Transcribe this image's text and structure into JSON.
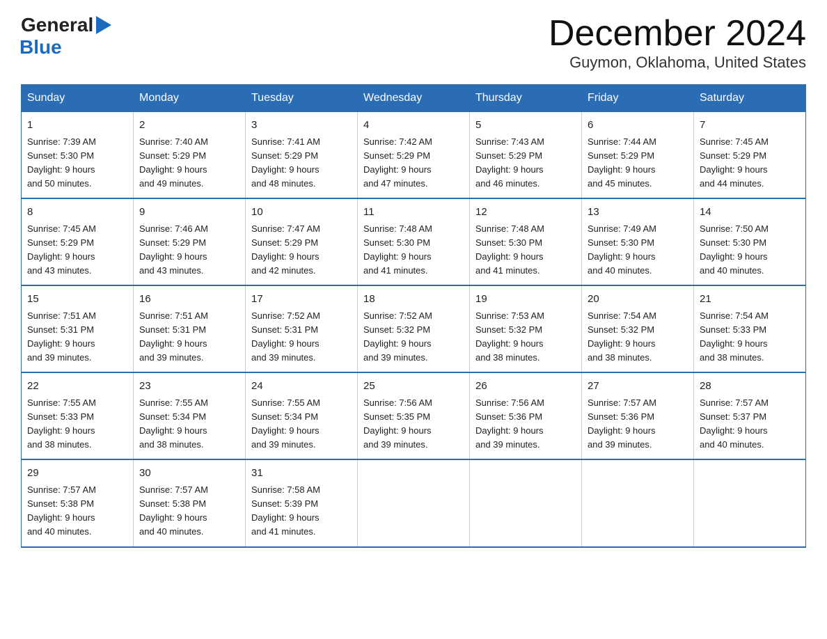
{
  "logo": {
    "general": "General",
    "blue": "Blue",
    "arrow": "▶"
  },
  "title": "December 2024",
  "subtitle": "Guymon, Oklahoma, United States",
  "days_of_week": [
    "Sunday",
    "Monday",
    "Tuesday",
    "Wednesday",
    "Thursday",
    "Friday",
    "Saturday"
  ],
  "weeks": [
    [
      {
        "day": "1",
        "sunrise": "7:39 AM",
        "sunset": "5:30 PM",
        "daylight": "9 hours and 50 minutes."
      },
      {
        "day": "2",
        "sunrise": "7:40 AM",
        "sunset": "5:29 PM",
        "daylight": "9 hours and 49 minutes."
      },
      {
        "day": "3",
        "sunrise": "7:41 AM",
        "sunset": "5:29 PM",
        "daylight": "9 hours and 48 minutes."
      },
      {
        "day": "4",
        "sunrise": "7:42 AM",
        "sunset": "5:29 PM",
        "daylight": "9 hours and 47 minutes."
      },
      {
        "day": "5",
        "sunrise": "7:43 AM",
        "sunset": "5:29 PM",
        "daylight": "9 hours and 46 minutes."
      },
      {
        "day": "6",
        "sunrise": "7:44 AM",
        "sunset": "5:29 PM",
        "daylight": "9 hours and 45 minutes."
      },
      {
        "day": "7",
        "sunrise": "7:45 AM",
        "sunset": "5:29 PM",
        "daylight": "9 hours and 44 minutes."
      }
    ],
    [
      {
        "day": "8",
        "sunrise": "7:45 AM",
        "sunset": "5:29 PM",
        "daylight": "9 hours and 43 minutes."
      },
      {
        "day": "9",
        "sunrise": "7:46 AM",
        "sunset": "5:29 PM",
        "daylight": "9 hours and 43 minutes."
      },
      {
        "day": "10",
        "sunrise": "7:47 AM",
        "sunset": "5:29 PM",
        "daylight": "9 hours and 42 minutes."
      },
      {
        "day": "11",
        "sunrise": "7:48 AM",
        "sunset": "5:30 PM",
        "daylight": "9 hours and 41 minutes."
      },
      {
        "day": "12",
        "sunrise": "7:48 AM",
        "sunset": "5:30 PM",
        "daylight": "9 hours and 41 minutes."
      },
      {
        "day": "13",
        "sunrise": "7:49 AM",
        "sunset": "5:30 PM",
        "daylight": "9 hours and 40 minutes."
      },
      {
        "day": "14",
        "sunrise": "7:50 AM",
        "sunset": "5:30 PM",
        "daylight": "9 hours and 40 minutes."
      }
    ],
    [
      {
        "day": "15",
        "sunrise": "7:51 AM",
        "sunset": "5:31 PM",
        "daylight": "9 hours and 39 minutes."
      },
      {
        "day": "16",
        "sunrise": "7:51 AM",
        "sunset": "5:31 PM",
        "daylight": "9 hours and 39 minutes."
      },
      {
        "day": "17",
        "sunrise": "7:52 AM",
        "sunset": "5:31 PM",
        "daylight": "9 hours and 39 minutes."
      },
      {
        "day": "18",
        "sunrise": "7:52 AM",
        "sunset": "5:32 PM",
        "daylight": "9 hours and 39 minutes."
      },
      {
        "day": "19",
        "sunrise": "7:53 AM",
        "sunset": "5:32 PM",
        "daylight": "9 hours and 38 minutes."
      },
      {
        "day": "20",
        "sunrise": "7:54 AM",
        "sunset": "5:32 PM",
        "daylight": "9 hours and 38 minutes."
      },
      {
        "day": "21",
        "sunrise": "7:54 AM",
        "sunset": "5:33 PM",
        "daylight": "9 hours and 38 minutes."
      }
    ],
    [
      {
        "day": "22",
        "sunrise": "7:55 AM",
        "sunset": "5:33 PM",
        "daylight": "9 hours and 38 minutes."
      },
      {
        "day": "23",
        "sunrise": "7:55 AM",
        "sunset": "5:34 PM",
        "daylight": "9 hours and 38 minutes."
      },
      {
        "day": "24",
        "sunrise": "7:55 AM",
        "sunset": "5:34 PM",
        "daylight": "9 hours and 39 minutes."
      },
      {
        "day": "25",
        "sunrise": "7:56 AM",
        "sunset": "5:35 PM",
        "daylight": "9 hours and 39 minutes."
      },
      {
        "day": "26",
        "sunrise": "7:56 AM",
        "sunset": "5:36 PM",
        "daylight": "9 hours and 39 minutes."
      },
      {
        "day": "27",
        "sunrise": "7:57 AM",
        "sunset": "5:36 PM",
        "daylight": "9 hours and 39 minutes."
      },
      {
        "day": "28",
        "sunrise": "7:57 AM",
        "sunset": "5:37 PM",
        "daylight": "9 hours and 40 minutes."
      }
    ],
    [
      {
        "day": "29",
        "sunrise": "7:57 AM",
        "sunset": "5:38 PM",
        "daylight": "9 hours and 40 minutes."
      },
      {
        "day": "30",
        "sunrise": "7:57 AM",
        "sunset": "5:38 PM",
        "daylight": "9 hours and 40 minutes."
      },
      {
        "day": "31",
        "sunrise": "7:58 AM",
        "sunset": "5:39 PM",
        "daylight": "9 hours and 41 minutes."
      },
      {
        "day": "",
        "sunrise": "",
        "sunset": "",
        "daylight": ""
      },
      {
        "day": "",
        "sunrise": "",
        "sunset": "",
        "daylight": ""
      },
      {
        "day": "",
        "sunrise": "",
        "sunset": "",
        "daylight": ""
      },
      {
        "day": "",
        "sunrise": "",
        "sunset": "",
        "daylight": ""
      }
    ]
  ],
  "labels": {
    "sunrise": "Sunrise:",
    "sunset": "Sunset:",
    "daylight": "Daylight:"
  }
}
